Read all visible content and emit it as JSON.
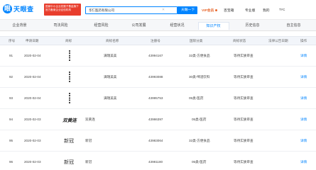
{
  "header": {
    "logo_text": "天眼查",
    "promo_line1": "国家中小企业发展子基金旗下",
    "promo_line2": "官方备案企业征信机构",
    "search_value": "华仁医药有限公司",
    "search_button": "天眼一下",
    "nav": [
      "VIP会员",
      "百宝箱",
      "专业版",
      "我的",
      "TYC"
    ]
  },
  "tabs": [
    {
      "label": "企业背景",
      "count": "",
      "active": false
    },
    {
      "label": "司法风险",
      "count": "",
      "active": false
    },
    {
      "label": "经营风险",
      "count": "",
      "active": false
    },
    {
      "label": "公司发展",
      "count": "",
      "active": false
    },
    {
      "label": "经营状况",
      "count": "",
      "active": false
    },
    {
      "label": "知识产权",
      "count": "",
      "active": true
    },
    {
      "label": "历史信息",
      "count": "",
      "active": false
    },
    {
      "label": "自主信息",
      "count": "",
      "active": false
    }
  ],
  "table": {
    "headers": [
      "序号",
      "申请日期",
      "商标",
      "商标名称",
      "注册号",
      "国际分类",
      "商标状态",
      "法律公告日期",
      "操作"
    ],
    "rows": [
      {
        "index": "91",
        "date": "2020-02-04",
        "mark_type": "vertical",
        "mark_text": "",
        "name": "满瑞美美",
        "reg_no": "43994167",
        "category": "32类-方便食品",
        "status": "等待实质审查",
        "op": "详情"
      },
      {
        "index": "92",
        "date": "2020-02-04",
        "mark_type": "vertical",
        "mark_text": "",
        "name": "满瑞美美",
        "reg_no": "43993088",
        "category": "30类-啤酒饮料",
        "status": "等待实质审查",
        "op": "详情"
      },
      {
        "index": "93",
        "date": "2020-02-04",
        "mark_type": "vertical",
        "mark_text": "",
        "name": "满瑞美美",
        "reg_no": "43995753",
        "category": "05类-医药",
        "status": "等待实质审查",
        "op": "详情"
      },
      {
        "index": "94",
        "date": "2020-02-03",
        "mark_type": "calligraphy",
        "mark_text": "双黄连",
        "name": "双黄连",
        "reg_no": "43986397",
        "category": "05类-医药",
        "status": "等待实质审查",
        "op": "详情"
      },
      {
        "index": "95",
        "date": "2020-02-03",
        "mark_type": "text",
        "mark_text": "新冠",
        "name": "新冠",
        "reg_no": "43983064",
        "category": "32类-方便食品",
        "status": "等待实质审查",
        "op": "详情"
      },
      {
        "index": "96",
        "date": "2020-02-03",
        "mark_type": "text",
        "mark_text": "新冠",
        "name": "新冠",
        "reg_no": "43981180",
        "category": "05类-医药",
        "status": "等待实质审查",
        "op": "详情"
      }
    ]
  },
  "colors": {
    "brand": "#0084ff",
    "vip": "#e8662b",
    "promo": "#e83d2c"
  },
  "icons": {
    "logo": "tianyancha-logo-icon",
    "clear": "close-icon"
  }
}
